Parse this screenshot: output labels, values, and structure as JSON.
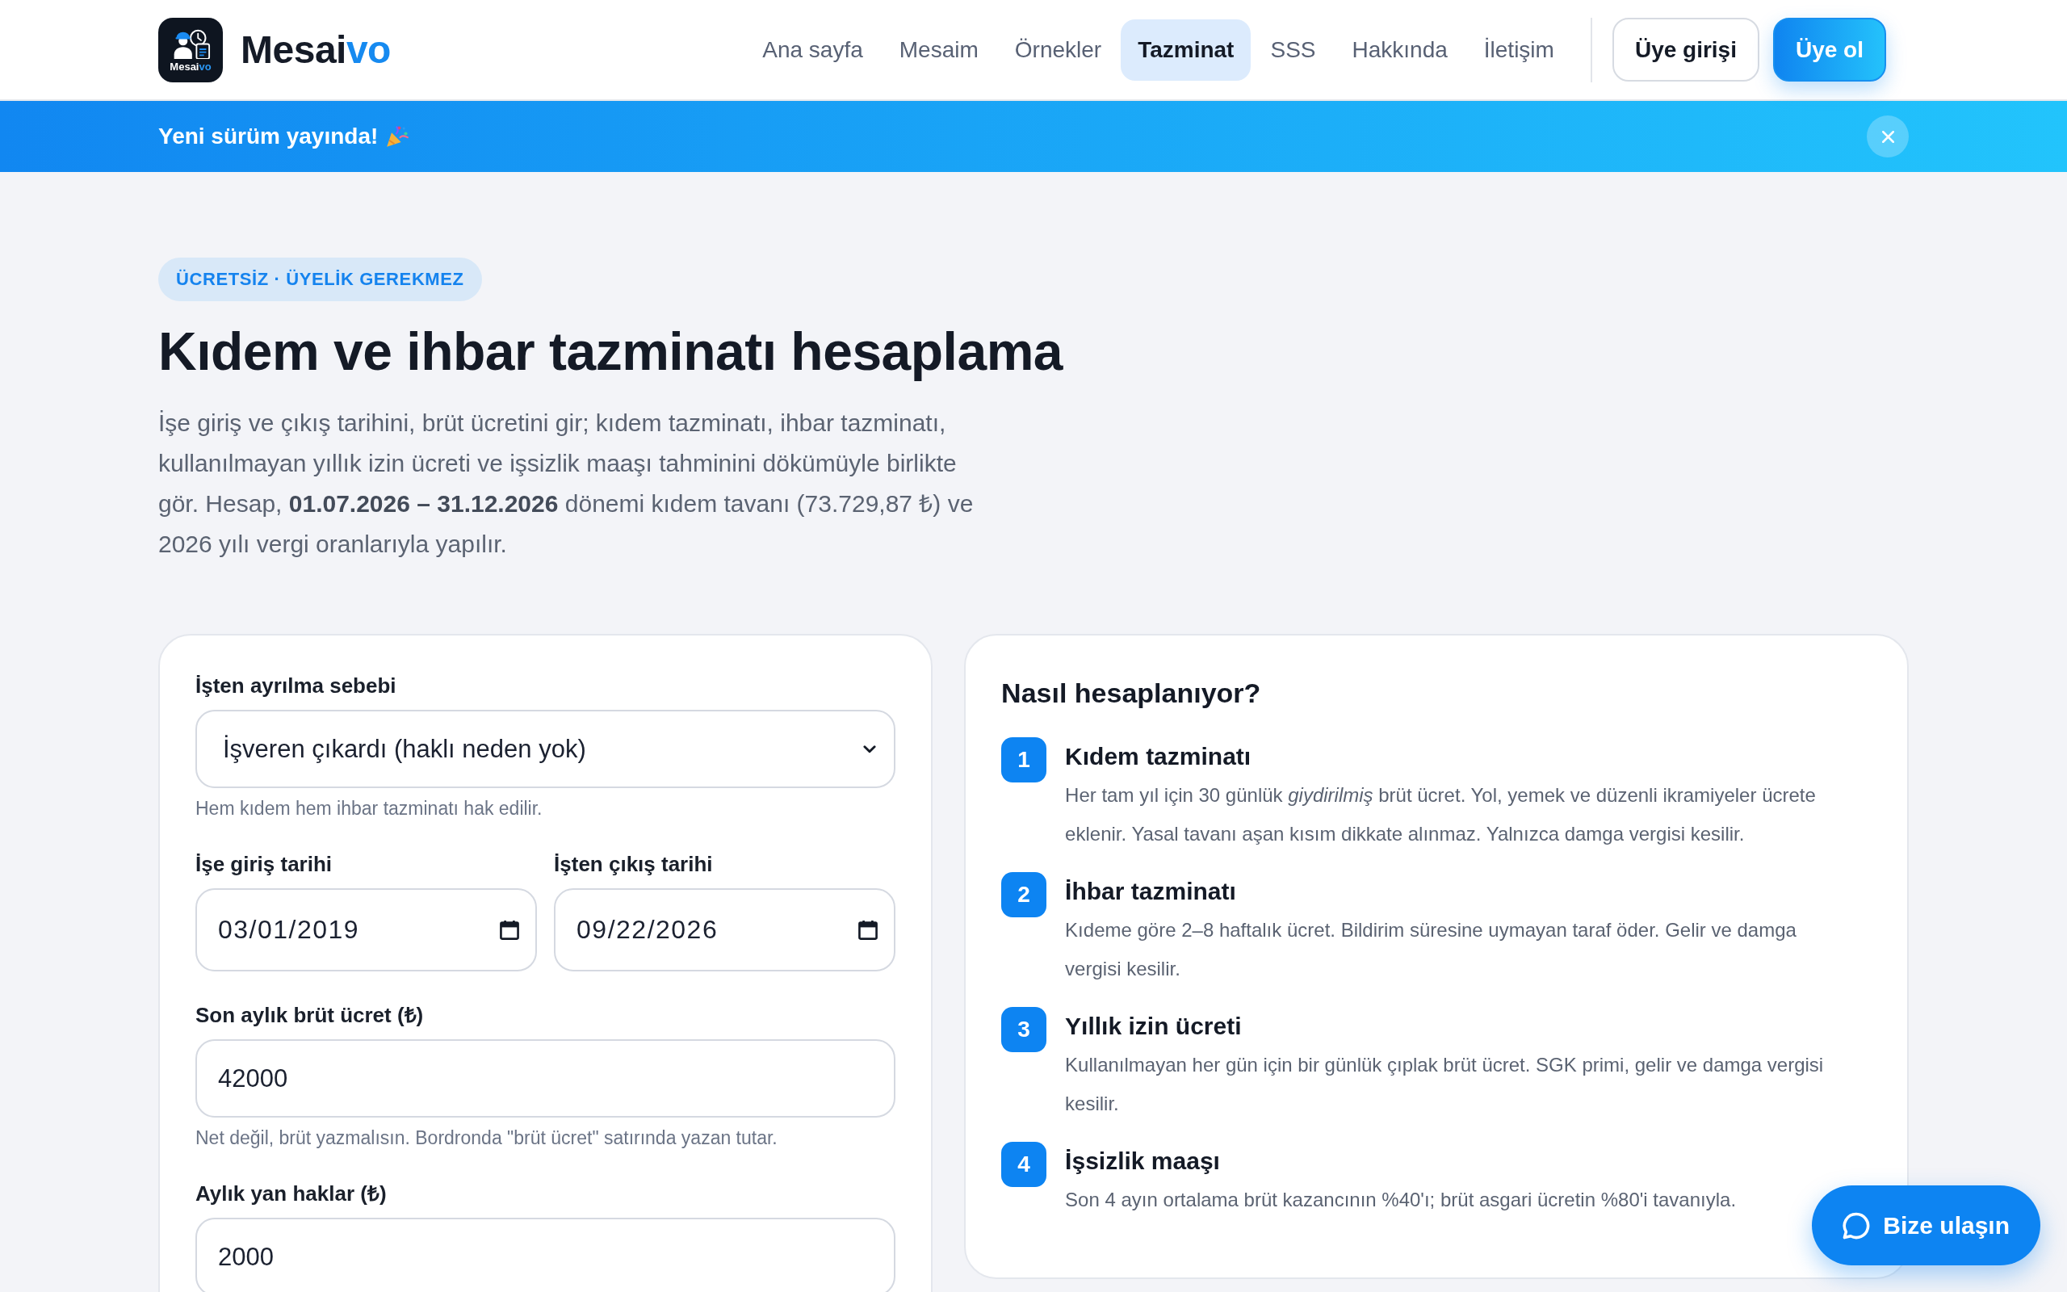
{
  "header": {
    "logo": {
      "badge_text": "Mesai",
      "badge_accent": "vo",
      "name": "Mesai",
      "name_accent": "vo"
    },
    "nav": [
      {
        "label": "Ana sayfa",
        "selected": false
      },
      {
        "label": "Mesaim",
        "selected": false
      },
      {
        "label": "Örnekler",
        "selected": false
      },
      {
        "label": "Tazminat",
        "selected": true
      },
      {
        "label": "SSS",
        "selected": false
      },
      {
        "label": "Hakkında",
        "selected": false
      },
      {
        "label": "İletişim",
        "selected": false
      }
    ],
    "actions": [
      {
        "kind": "outline",
        "label": "Üye girişi"
      },
      {
        "kind": "primary",
        "label": "Üye ol"
      }
    ]
  },
  "banner": {
    "text": "Yeni sürüm yayında!"
  },
  "hero": {
    "tag": "ÜCRETSİZ · ÜYELİK GEREKMEZ",
    "title": "Kıdem ve ihbar tazminatı hesaplama",
    "intro": "İşe giriş ve çıkış tarihini, brüt ücretini gir; kıdem tazminatı, ihbar tazminatı, kullanılmayan yıllık izin ücreti ve işsizlik maaşı tahminini dökümüyle birlikte gör. Hesap, **01.07.2026 – 31.12.2026** dönemi kıdem tavanı (73.729,87 ₺) ve 2026 yılı vergi oranlarıyla yapılır."
  },
  "form": {
    "fields": [
      {
        "kind": "select",
        "label": "İşten ayrılma sebebi",
        "value": "İşveren çıkardı (haklı neden yok)",
        "hint": "Hem kıdem hem ihbar tazminatı hak edilir."
      },
      {
        "kind": "dates",
        "items": [
          {
            "label": "İşe giriş tarihi",
            "value": "03/01/2019"
          },
          {
            "label": "İşten çıkış tarihi",
            "value": "09/22/2026"
          }
        ]
      },
      {
        "kind": "text",
        "label": "Son aylık brüt ücret (₺)",
        "value": "42000",
        "hint": "Net değil, brüt yazmalısın. Bordronda \"brüt ücret\" satırında yazan tutar."
      },
      {
        "kind": "text",
        "label": "Aylık yan haklar (₺)",
        "value": "2000"
      }
    ]
  },
  "explainer": {
    "title": "Nasıl hesaplanıyor?",
    "steps": [
      {
        "number": "1",
        "title": "Kıdem tazminatı",
        "text": "Her tam yıl için 30 günlük *giydirilmiş* brüt ücret. Yol, yemek ve düzenli ikramiyeler ücrete eklenir. Yasal tavanı aşan kısım dikkate alınmaz. Yalnızca damga vergisi kesilir."
      },
      {
        "number": "2",
        "title": "İhbar tazminatı",
        "text": "Kıdeme göre 2–8 haftalık ücret. Bildirim süresine uymayan taraf öder. Gelir ve damga vergisi kesilir."
      },
      {
        "number": "3",
        "title": "Yıllık izin ücreti",
        "text": "Kullanılmayan her gün için bir günlük çıplak brüt ücret. SGK primi, gelir ve damga vergisi kesilir."
      },
      {
        "number": "4",
        "title": "İşsizlik maaşı",
        "text": "Son 4 ayın ortalama brüt kazancının %40'ı; brüt asgari ücretin %80'i tavanıyla."
      }
    ]
  },
  "chat": {
    "label": "Bize ulaşın"
  }
}
